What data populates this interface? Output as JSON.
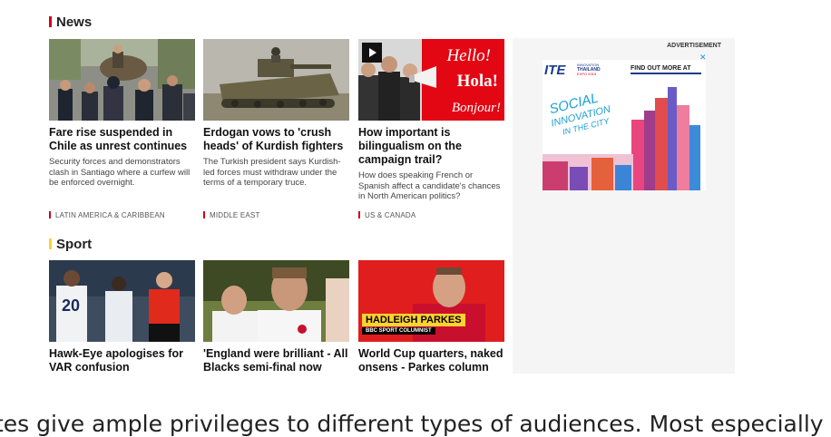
{
  "news": {
    "title": "News",
    "title_bar_color": "#d0021b",
    "cards": [
      {
        "headline": "Fare rise suspended in Chile as unrest continues",
        "summary": "Security forces and demonstrators clash in Santiago where a curfew will be enforced overnight.",
        "tag": "LATIN AMERICA & CARIBBEAN"
      },
      {
        "headline": "Erdogan vows to 'crush heads' of Kurdish fighters",
        "summary": "The Turkish president says Kurdish-led forces must withdraw under the terms of a temporary truce.",
        "tag": "MIDDLE EAST"
      },
      {
        "headline": "How important is bilingualism on the campaign trail?",
        "summary": "How does speaking French or Spanish affect a candidate's chances in North American politics?",
        "tag": "US & CANADA",
        "image_words": [
          "Hello!",
          "Hola!",
          "Bonjour!"
        ]
      }
    ]
  },
  "sport": {
    "title": "Sport",
    "title_bar_color": "#ffd230",
    "cards": [
      {
        "headline": "Hawk-Eye apologises for VAR confusion",
        "image_number": "20"
      },
      {
        "headline": "'England were brilliant - All Blacks semi-final now"
      },
      {
        "headline": "World Cup quarters, naked onsens - Parkes column",
        "caption_name": "HADLEIGH PARKES",
        "caption_role": "BBC SPORT COLUMNIST"
      }
    ]
  },
  "advertisement": {
    "label": "ADVERTISEMENT",
    "close": "✕",
    "logo": "ITE",
    "logo_sub1": "INNOVATION",
    "logo_sub2": "THAILAND",
    "logo_sub3": "EXPO 2019",
    "cta": "FIND OUT MORE AT",
    "slogan1": "SOCIAL",
    "slogan2": "INNOVATION",
    "slogan3": "IN THE CITY"
  },
  "bottom_text": "tes give ample privileges to different types of audiences. Most especially"
}
